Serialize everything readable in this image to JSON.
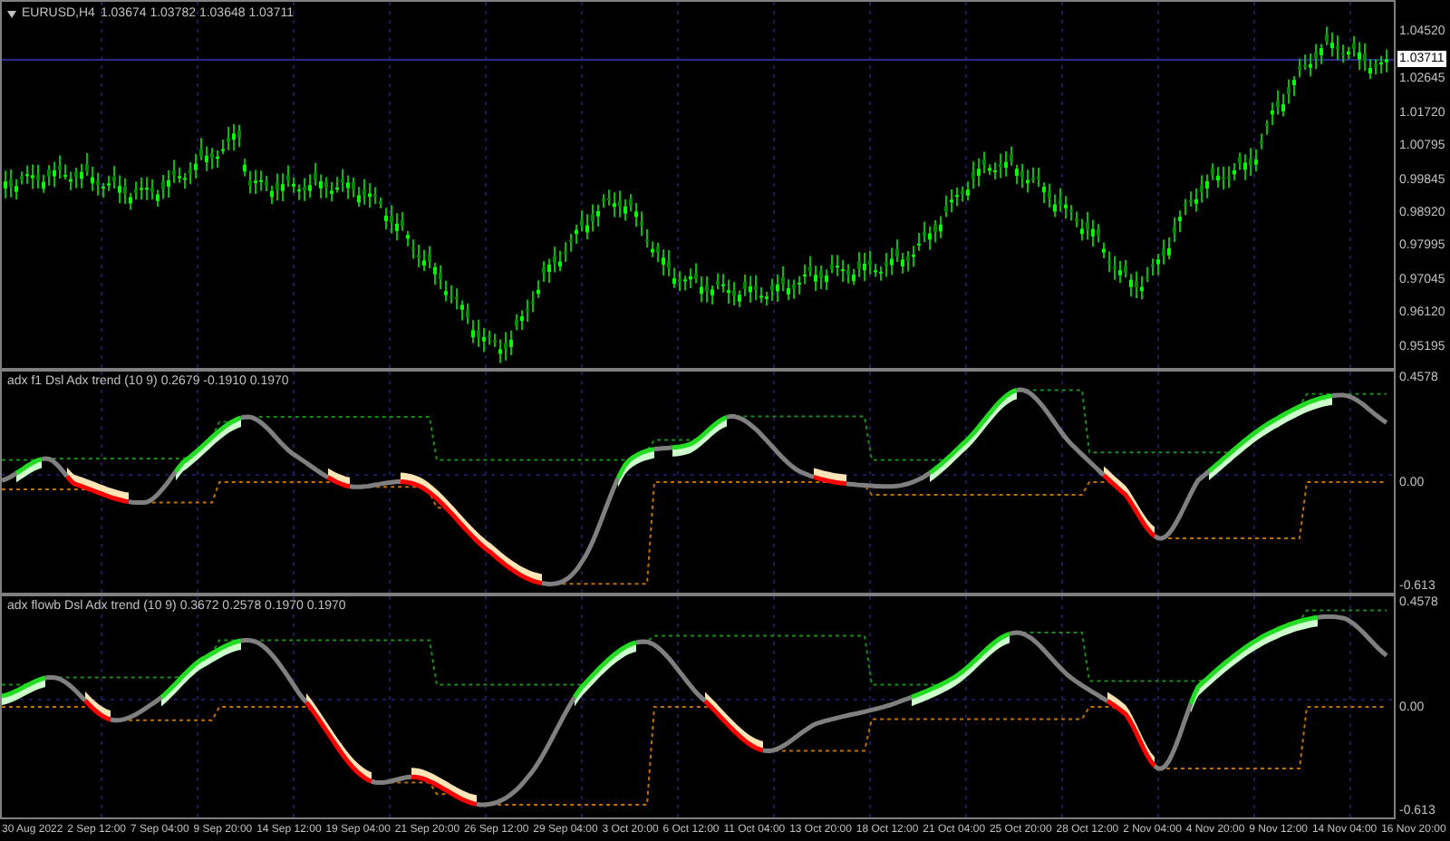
{
  "main_chart": {
    "title": "EURUSD,H4",
    "ohlc": "1.03674 1.03782 1.03648 1.03711",
    "current_price": "1.03711",
    "price_labels": [
      "1.04520",
      "1.02645",
      "1.01720",
      "1.00795",
      "0.99845",
      "0.98920",
      "0.97995",
      "0.97045",
      "0.96120",
      "0.95195"
    ]
  },
  "indicator_panes": [
    {
      "title": "adx f1 Dsl Adx trend (10 9) 0.2679 -0.1910 0.1970",
      "labels": [
        "0.4578",
        "0.00",
        "-0.613"
      ]
    },
    {
      "title": "adx flowb Dsl Adx trend (10 9) 0.3672 0.2578 0.1970 0.1970",
      "labels": [
        "0.4578",
        "0.00",
        "-0.613"
      ]
    }
  ],
  "time_axis": [
    "30 Aug 2022",
    "2 Sep 12:00",
    "7 Sep 04:00",
    "9 Sep 20:00",
    "14 Sep 12:00",
    "19 Sep 04:00",
    "21 Sep 20:00",
    "26 Sep 12:00",
    "29 Sep 04:00",
    "3 Oct 20:00",
    "6 Oct 12:00",
    "11 Oct 04:00",
    "13 Oct 20:00",
    "18 Oct 12:00",
    "21 Oct 04:00",
    "25 Oct 20:00",
    "28 Oct 12:00",
    "2 Nov 04:00",
    "4 Nov 20:00",
    "9 Nov 12:00",
    "14 Nov 04:00",
    "16 Nov 20:00"
  ]
}
